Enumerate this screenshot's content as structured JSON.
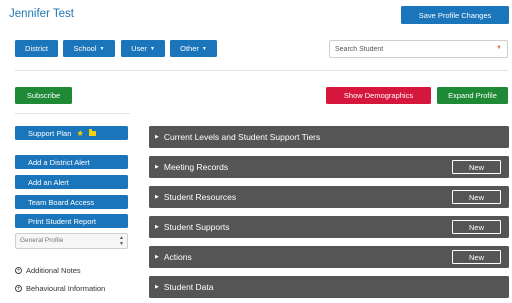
{
  "header": {
    "title": "Jennifer Test",
    "save_label": "Save Profile Changes"
  },
  "nav": {
    "district": "District",
    "school": "School",
    "user": "User",
    "other": "Other"
  },
  "search": {
    "placeholder": "Search Student"
  },
  "actions": {
    "subscribe": "Subscribe",
    "show_demographics": "Show Demographics",
    "expand_profile": "Expand Profile"
  },
  "sidebar": {
    "support_plan": "Support Plan",
    "buttons": [
      "Add a District Alert",
      "Add an Alert",
      "Team Board Access",
      "Print Student Report"
    ],
    "profile_select": "General Profile",
    "links": [
      "Additional Notes",
      "Behavioural Information"
    ]
  },
  "sections": [
    {
      "title": "Current Levels and Student Support Tiers",
      "button": ""
    },
    {
      "title": "Meeting Records",
      "button": "New"
    },
    {
      "title": "Student Resources",
      "button": "New"
    },
    {
      "title": "Student Supports",
      "button": "New"
    },
    {
      "title": "Actions",
      "button": "New"
    },
    {
      "title": "Student Data",
      "button": ""
    }
  ],
  "colors": {
    "primary": "#1b75bb",
    "success": "#1f8a35",
    "danger": "#d5173d",
    "section": "#555555",
    "accent": "#f5d10a"
  },
  "icons": [
    "star-icon",
    "folder-icon",
    "caret-down-icon",
    "caret-right-icon",
    "plus-circle-icon"
  ]
}
